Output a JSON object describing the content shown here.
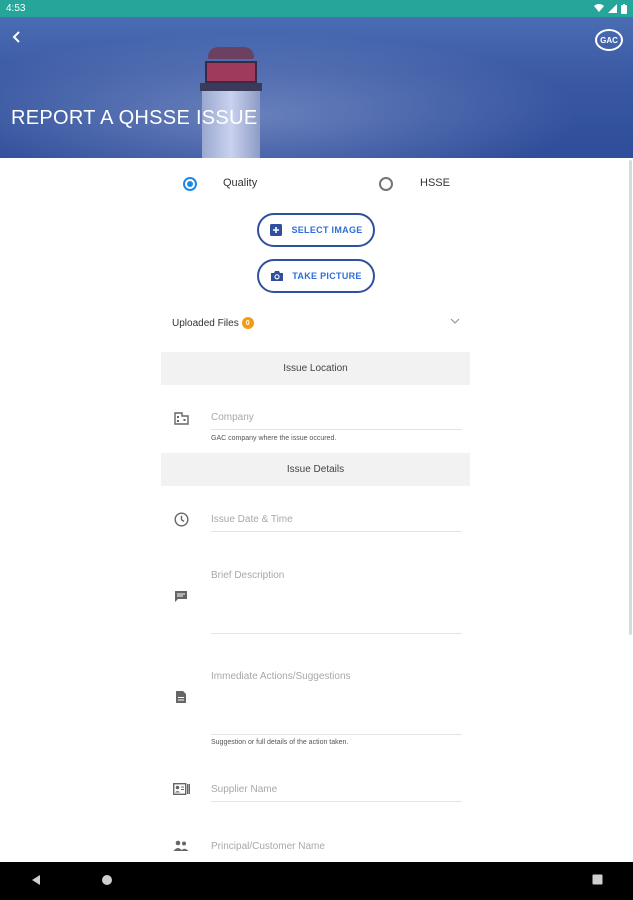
{
  "status_bar": {
    "time": "4:53"
  },
  "header": {
    "title": "REPORT A QHSSE ISSUE",
    "logo_text": "GAC"
  },
  "report_type": {
    "options": [
      {
        "label": "Quality",
        "selected": true
      },
      {
        "label": "HSSE",
        "selected": false
      }
    ]
  },
  "buttons": {
    "select_image": "SELECT IMAGE",
    "take_picture": "TAKE PICTURE"
  },
  "uploaded_files": {
    "label": "Uploaded Files",
    "count": "0"
  },
  "sections": {
    "issue_location": "Issue Location",
    "issue_details": "Issue Details"
  },
  "fields": {
    "company": {
      "placeholder": "Company",
      "helper": "GAC company where the issue occured."
    },
    "issue_datetime": {
      "placeholder": "Issue Date & Time"
    },
    "brief_description": {
      "placeholder": "Brief Description"
    },
    "immediate_actions": {
      "placeholder": "Immediate Actions/Suggestions",
      "helper": "Suggestion or full details of the action taken."
    },
    "supplier_name": {
      "placeholder": "Supplier Name"
    },
    "principal_customer_name": {
      "placeholder": "Principal/Customer Name"
    }
  },
  "colors": {
    "status_bar": "#26a69a",
    "accent": "#1e88e5",
    "button_border": "#2f4f9f",
    "badge": "#f39c12"
  }
}
